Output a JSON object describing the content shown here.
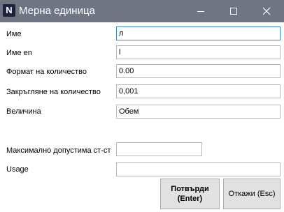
{
  "window": {
    "title": "Мерна единица",
    "app_icon_letter": "N"
  },
  "form": {
    "fields": [
      {
        "label": "Име",
        "value": "л"
      },
      {
        "label": "Име en",
        "value": "l"
      },
      {
        "label": "Формат на количество",
        "value": "0.00"
      },
      {
        "label": "Закръгляне на количество",
        "value": "0,001"
      },
      {
        "label": "Величина",
        "value": "Обем"
      },
      {
        "label": "Максимално допустима ст-ст",
        "value": ""
      },
      {
        "label": "Usage",
        "value": ""
      }
    ]
  },
  "buttons": {
    "confirm_line1": "Потвърди",
    "confirm_line2": "(Enter)",
    "cancel": "Откажи (Esc)"
  }
}
